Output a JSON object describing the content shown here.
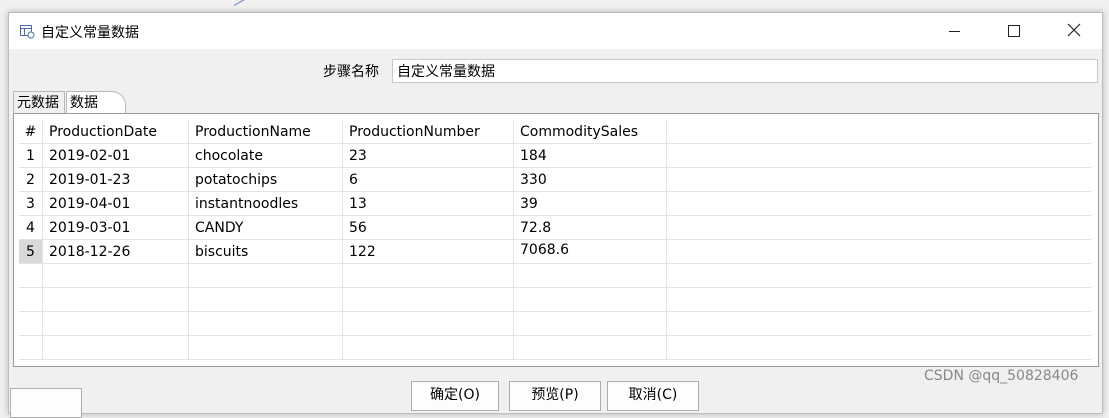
{
  "window": {
    "title": "自定义常量数据",
    "controls": {
      "minimize": "minimize-icon",
      "maximize": "maximize-icon",
      "close": "close-icon"
    }
  },
  "step": {
    "label": "步骤名称",
    "value": "自定义常量数据"
  },
  "tabs": [
    {
      "label": "元数据"
    },
    {
      "label": "数据"
    }
  ],
  "table": {
    "headers": [
      "#",
      "ProductionDate",
      "ProductionName",
      "ProductionNumber",
      "CommoditySales"
    ],
    "rows": [
      [
        "1",
        "2019-02-01",
        "chocolate",
        "23",
        "184"
      ],
      [
        "2",
        "2019-01-23",
        "potatochips",
        "6",
        "330"
      ],
      [
        "3",
        "2019-04-01",
        "instantnoodles",
        "13",
        "39"
      ],
      [
        "4",
        "2019-03-01",
        "CANDY",
        "56",
        "72.8"
      ],
      [
        "5",
        "2018-12-26",
        "biscuits",
        "122",
        "7068.6"
      ]
    ]
  },
  "buttons": {
    "ok": "确定(O)",
    "preview": "预览(P)",
    "cancel": "取消(C)"
  },
  "watermark": "CSDN @qq_50828406"
}
